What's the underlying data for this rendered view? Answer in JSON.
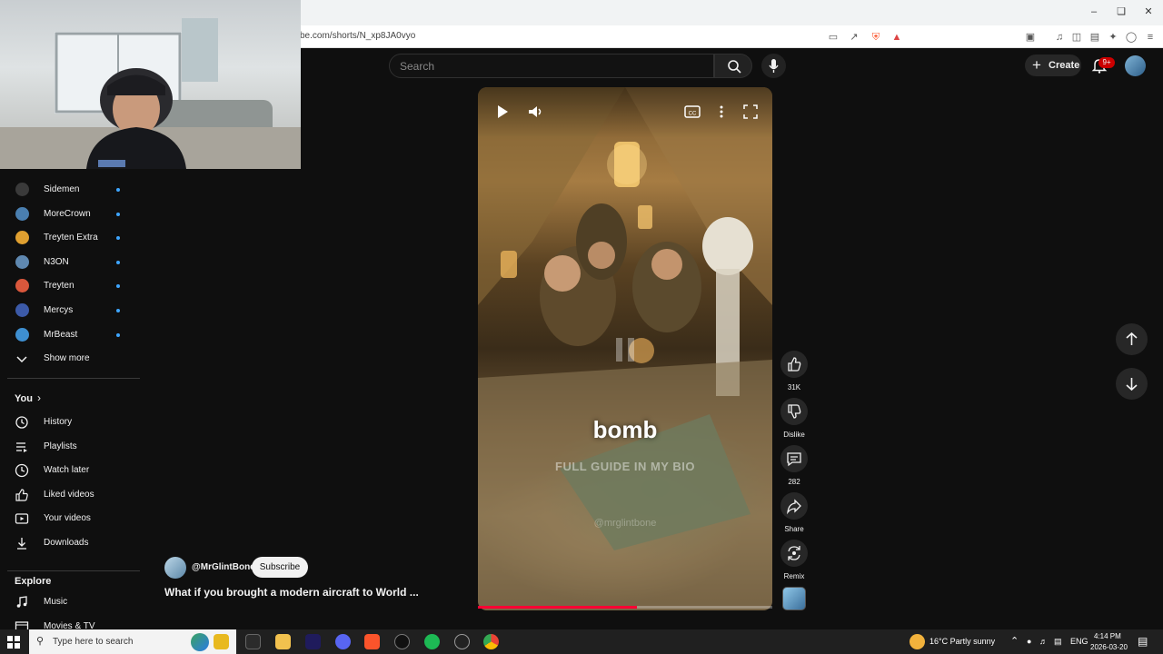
{
  "browser": {
    "url": "be.com/shorts/N_xp8JA0vyo"
  },
  "header": {
    "search_placeholder": "Search",
    "create_label": "Create",
    "notif_badge": "9+"
  },
  "sidebar": {
    "subscriptions": [
      {
        "name": "Sidemen",
        "color": "#3a3a3a"
      },
      {
        "name": "MoreCrown",
        "color": "#4a7fb0"
      },
      {
        "name": "Treyten Extra",
        "color": "#e0a030"
      },
      {
        "name": "N3ON",
        "color": "#5f88b0"
      },
      {
        "name": "Treyten",
        "color": "#d9573c"
      },
      {
        "name": "Mercys",
        "color": "#3c5aa8"
      },
      {
        "name": "MrBeast",
        "color": "#3e8fd1"
      }
    ],
    "show_more": "Show more",
    "you_label": "You",
    "you_items": [
      {
        "label": "History",
        "icon": "history-icon"
      },
      {
        "label": "Playlists",
        "icon": "playlists-icon"
      },
      {
        "label": "Watch later",
        "icon": "clock-icon"
      },
      {
        "label": "Liked videos",
        "icon": "thumbs-up-icon"
      },
      {
        "label": "Your videos",
        "icon": "video-icon"
      },
      {
        "label": "Downloads",
        "icon": "download-icon"
      }
    ],
    "explore_label": "Explore",
    "explore_items": [
      {
        "label": "Music",
        "icon": "music-icon"
      },
      {
        "label": "Movies & TV",
        "icon": "film-icon"
      }
    ]
  },
  "video": {
    "caption_main": "bomb",
    "caption_sub": "FULL GUIDE IN MY BIO",
    "watermark": "@mrglintbone",
    "progress": 0.54
  },
  "actions": {
    "likes": "31K",
    "dislike": "Dislike",
    "comments": "282",
    "share": "Share",
    "remix": "Remix"
  },
  "channel": {
    "handle": "@MrGlintBone",
    "subscribe": "Subscribe",
    "title": "What if you brought a modern aircraft to World ..."
  },
  "taskbar": {
    "search_placeholder": "Type here to search",
    "weather": "16°C  Partly sunny",
    "lang": "ENG",
    "time": "4:14 PM",
    "date": "2026-03-20"
  },
  "colors": {
    "accent_red": "#ff0033",
    "link_blue": "#3ea6ff"
  }
}
